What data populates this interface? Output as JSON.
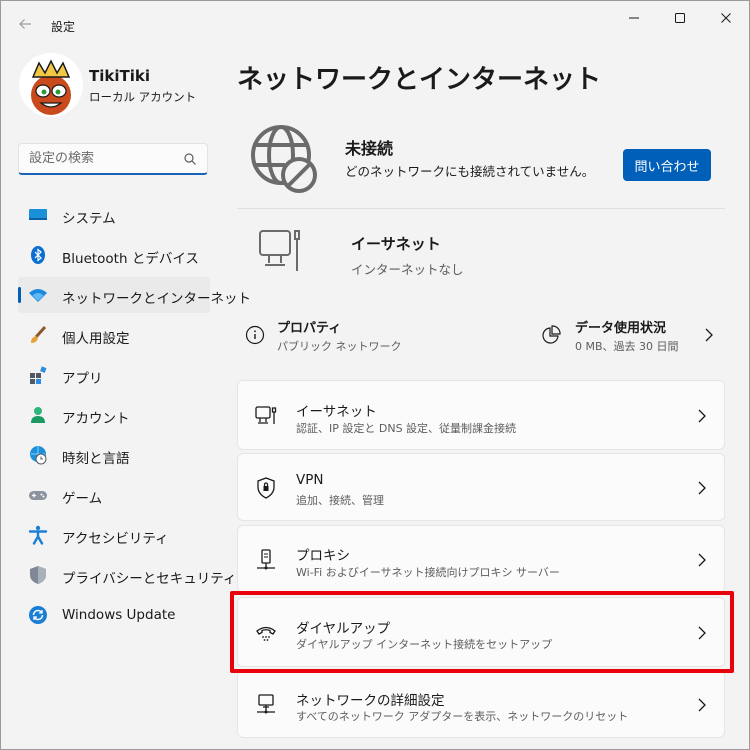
{
  "window": {
    "title": "設定"
  },
  "profile": {
    "name": "TikiTiki",
    "type": "ローカル アカウント"
  },
  "search": {
    "placeholder": "設定の検索"
  },
  "nav": [
    {
      "label": "システム",
      "icon": "monitor-icon"
    },
    {
      "label": "Bluetooth とデバイス",
      "icon": "bluetooth-icon"
    },
    {
      "label": "ネットワークとインターネット",
      "icon": "wifi-icon",
      "active": true
    },
    {
      "label": "個人用設定",
      "icon": "brush-icon"
    },
    {
      "label": "アプリ",
      "icon": "apps-icon"
    },
    {
      "label": "アカウント",
      "icon": "person-icon"
    },
    {
      "label": "時刻と言語",
      "icon": "globe-clock-icon"
    },
    {
      "label": "ゲーム",
      "icon": "gamepad-icon"
    },
    {
      "label": "アクセシビリティ",
      "icon": "accessibility-icon"
    },
    {
      "label": "プライバシーとセキュリティ",
      "icon": "shield-icon"
    },
    {
      "label": "Windows Update",
      "icon": "update-icon"
    }
  ],
  "main": {
    "title": "ネットワークとインターネット",
    "status": {
      "title": "未接続",
      "description": "どのネットワークにも接続されていません。",
      "help_button": "問い合わせ"
    },
    "ethernet_status": {
      "title": "イーサネット",
      "subtitle": "インターネットなし"
    },
    "properties": {
      "title": "プロパティ",
      "subtitle": "パブリック ネットワーク"
    },
    "data_usage": {
      "title": "データ使用状況",
      "subtitle": "0 MB、過去 30 日間"
    },
    "cards": [
      {
        "title": "イーサネット",
        "subtitle": "認証、IP 設定と DNS 設定、従量制課金接続",
        "icon": "ethernet-icon"
      },
      {
        "title": "VPN",
        "subtitle": "追加、接続、管理",
        "icon": "vpn-shield-icon"
      },
      {
        "title": "プロキシ",
        "subtitle": "Wi-Fi およびイーサネット接続向けプロキシ サーバー",
        "icon": "proxy-icon"
      },
      {
        "title": "ダイヤルアップ",
        "subtitle": "ダイヤルアップ インターネット接続をセットアップ",
        "icon": "dialup-phone-icon"
      },
      {
        "title": "ネットワークの詳細設定",
        "subtitle": "すべてのネットワーク アダプターを表示、ネットワークのリセット",
        "icon": "network-pc-icon"
      }
    ]
  },
  "colors": {
    "accent": "#005fb8",
    "highlight": "#e8000b"
  }
}
